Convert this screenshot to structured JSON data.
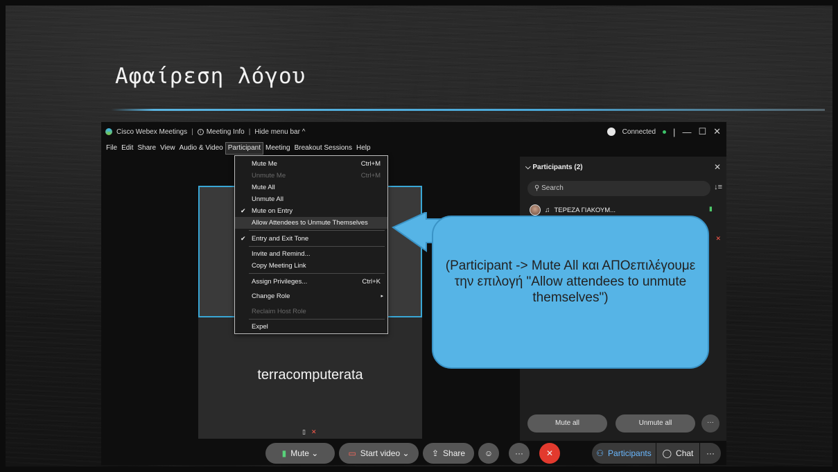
{
  "slide": {
    "title": "Αφαίρεση λόγου"
  },
  "titlebar": {
    "app_name": "Cisco Webex Meetings",
    "meeting_info": "Meeting Info",
    "hide_menu": "Hide menu bar ^",
    "status": "Connected",
    "info_icon": "i"
  },
  "menubar": {
    "file": "File",
    "edit": "Edit",
    "share": "Share",
    "view": "View",
    "audio_video": "Audio & Video",
    "participant": "Participant",
    "meeting": "Meeting",
    "breakout": "Breakout Sessions",
    "help": "Help"
  },
  "participant_menu": {
    "mute_me": "Mute Me",
    "mute_me_sc": "Ctrl+M",
    "unmute_me": "Unmute Me",
    "unmute_me_sc": "Ctrl+M",
    "mute_all": "Mute All",
    "unmute_all": "Unmute All",
    "mute_on_entry": "Mute on Entry",
    "allow_unmute": "Allow Attendees to Unmute Themselves",
    "entry_exit_tone": "Entry and Exit Tone",
    "invite": "Invite and Remind...",
    "copy_link": "Copy Meeting Link",
    "assign_privileges": "Assign Privileges...",
    "assign_privileges_sc": "Ctrl+K",
    "change_role": "Change Role",
    "reclaim_host": "Reclaim Host Role",
    "expel": "Expel",
    "check": "✔"
  },
  "stage": {
    "participant_name": "terracomputerata"
  },
  "participants_panel": {
    "header": "Participants (2)",
    "search_placeholder": "Search",
    "participant_1": "ΤΕΡΕΖΑ ΓΙΑΚΟΥΜ...",
    "mute_all": "Mute all",
    "unmute_all": "Unmute all",
    "more": "···"
  },
  "controls": {
    "mute": "Mute",
    "start_video": "Start video",
    "share": "Share",
    "more": "···",
    "participants": "Participants",
    "chat": "Chat"
  },
  "callout": {
    "text": "(Participant -> Mute All και ΑΠΟεπιλέγουμε την επιλογή \"Allow attendees to unmute themselves\")"
  },
  "colors": {
    "accent": "#39a7d6",
    "callout_fill": "#56b4e6",
    "leave_red": "#e23a2e",
    "connected_green": "#3cc36a"
  }
}
